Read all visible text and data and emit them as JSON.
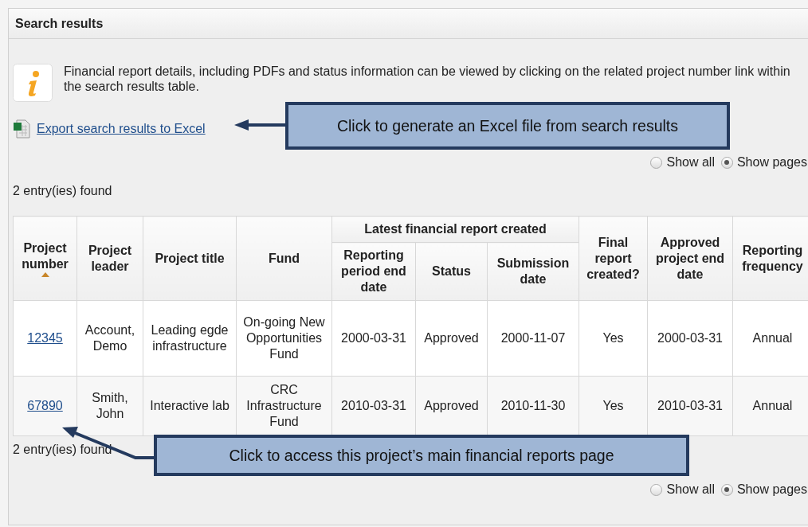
{
  "panel": {
    "title": "Search results"
  },
  "info": {
    "text": "Financial report details, including PDFs and status information can be viewed by clicking on the related project number link within the search results table."
  },
  "export_link": "Export search results to Excel",
  "pager_top": [
    {
      "label": "Show all",
      "selected": false
    },
    {
      "label": "Show pages",
      "selected": true
    }
  ],
  "count_top": "2 entry(ies) found",
  "table": {
    "group_header": "Latest financial report created",
    "columns_before": [
      {
        "label": "Project number",
        "sorted": true
      },
      {
        "label": "Project leader",
        "sorted": false
      },
      {
        "label": "Project title",
        "sorted": false
      },
      {
        "label": "Fund",
        "sorted": false
      }
    ],
    "group_columns": [
      {
        "label": "Reporting period end date",
        "sorted": false
      },
      {
        "label": "Status",
        "sorted": false
      },
      {
        "label": "Submission date",
        "sorted": false
      }
    ],
    "columns_after": [
      {
        "label": "Final report created?",
        "sorted": false
      },
      {
        "label": "Approved project end date",
        "sorted": false
      },
      {
        "label": "Reporting frequency",
        "sorted": false
      }
    ],
    "rows": [
      [
        "12345",
        "Account, Demo",
        "Leading egde infrastructure",
        "On-going New Opportunities Fund",
        "2000-03-31",
        "Approved",
        "2000-11-07",
        "Yes",
        "2000-03-31",
        "Annual"
      ],
      [
        "67890",
        "Smith, John",
        "Interactive lab",
        "CRC Infrastructure Fund",
        "2010-03-31",
        "Approved",
        "2010-11-30",
        "Yes",
        "2010-03-31",
        "Annual"
      ]
    ]
  },
  "count_bottom": "2 entry(ies) found",
  "pager_bottom": [
    {
      "label": "Show all",
      "selected": false
    },
    {
      "label": "Show pages",
      "selected": true
    }
  ],
  "callouts": [
    {
      "text": "Click to generate an Excel file from search results"
    },
    {
      "text": "Click to access this project’s main financial reports page"
    }
  ]
}
